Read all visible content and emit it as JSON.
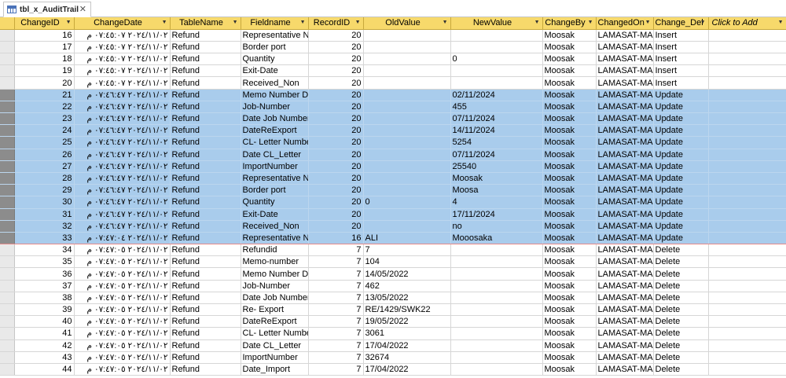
{
  "tab": {
    "title": "tbl_x_AuditTrail"
  },
  "colors": {
    "header": "#f7d96b",
    "selection": "#a9ccec",
    "selection_border": "#e58a8a"
  },
  "columns": [
    "ChangeID",
    "ChangeDate",
    "TableName",
    "Fieldname",
    "RecordID",
    "OldValue",
    "NewValue",
    "ChangeBy",
    "ChangedOn",
    "Change_Del",
    "Click to Add"
  ],
  "rows": [
    {
      "id": "16",
      "date": "٢٠٢٤/١١/٠٢ ٠٧:٤٥:٠٧ م",
      "table": "Refund",
      "field": "Representative N",
      "record": "20",
      "old": "",
      "new": "",
      "by": "Moosak",
      "on": "LAMASAT-MAI",
      "del": "Insert"
    },
    {
      "id": "17",
      "date": "٢٠٢٤/١١/٠٢ ٠٧:٤٥:٠٧ م",
      "table": "Refund",
      "field": "Border port",
      "record": "20",
      "old": "",
      "new": "",
      "by": "Moosak",
      "on": "LAMASAT-MAI",
      "del": "Insert"
    },
    {
      "id": "18",
      "date": "٢٠٢٤/١١/٠٢ ٠٧:٤٥:٠٧ م",
      "table": "Refund",
      "field": "Quantity",
      "record": "20",
      "old": "",
      "new": "0",
      "by": "Moosak",
      "on": "LAMASAT-MAI",
      "del": "Insert"
    },
    {
      "id": "19",
      "date": "٢٠٢٤/١١/٠٢ ٠٧:٤٥:٠٧ م",
      "table": "Refund",
      "field": "Exit-Date",
      "record": "20",
      "old": "",
      "new": "",
      "by": "Moosak",
      "on": "LAMASAT-MAI",
      "del": "Insert"
    },
    {
      "id": "20",
      "date": "٢٠٢٤/١١/٠٢ ٠٧:٤٥:٠٧ م",
      "table": "Refund",
      "field": "Received_Non",
      "record": "20",
      "old": "",
      "new": "",
      "by": "Moosak",
      "on": "LAMASAT-MAI",
      "del": "Insert"
    },
    {
      "id": "21",
      "date": "٢٠٢٤/١١/٠٢ ٠٧:٤٦:٤٧ م",
      "table": "Refund",
      "field": "Memo Number D",
      "record": "20",
      "old": "",
      "new": "02/11/2024",
      "by": "Moosak",
      "on": "LAMASAT-MAI",
      "del": "Update",
      "sel": true
    },
    {
      "id": "22",
      "date": "٢٠٢٤/١١/٠٢ ٠٧:٤٦:٤٧ م",
      "table": "Refund",
      "field": "Job-Number",
      "record": "20",
      "old": "",
      "new": "455",
      "by": "Moosak",
      "on": "LAMASAT-MAI",
      "del": "Update",
      "sel": true
    },
    {
      "id": "23",
      "date": "٢٠٢٤/١١/٠٢ ٠٧:٤٦:٤٧ م",
      "table": "Refund",
      "field": "Date Job Number",
      "record": "20",
      "old": "",
      "new": "07/11/2024",
      "by": "Moosak",
      "on": "LAMASAT-MAI",
      "del": "Update",
      "sel": true
    },
    {
      "id": "24",
      "date": "٢٠٢٤/١١/٠٢ ٠٧:٤٦:٤٧ م",
      "table": "Refund",
      "field": "DateReExport",
      "record": "20",
      "old": "",
      "new": "14/11/2024",
      "by": "Moosak",
      "on": "LAMASAT-MAI",
      "del": "Update",
      "sel": true
    },
    {
      "id": "25",
      "date": "٢٠٢٤/١١/٠٢ ٠٧:٤٦:٤٧ م",
      "table": "Refund",
      "field": "CL- Letter Numbe",
      "record": "20",
      "old": "",
      "new": "5254",
      "by": "Moosak",
      "on": "LAMASAT-MAI",
      "del": "Update",
      "sel": true
    },
    {
      "id": "26",
      "date": "٢٠٢٤/١١/٠٢ ٠٧:٤٦:٤٧ م",
      "table": "Refund",
      "field": "Date CL_Letter",
      "record": "20",
      "old": "",
      "new": "07/11/2024",
      "by": "Moosak",
      "on": "LAMASAT-MAI",
      "del": "Update",
      "sel": true
    },
    {
      "id": "27",
      "date": "٢٠٢٤/١١/٠٢ ٠٧:٤٦:٤٧ م",
      "table": "Refund",
      "field": "ImportNumber",
      "record": "20",
      "old": "",
      "new": "25540",
      "by": "Moosak",
      "on": "LAMASAT-MAI",
      "del": "Update",
      "sel": true
    },
    {
      "id": "28",
      "date": "٢٠٢٤/١١/٠٢ ٠٧:٤٦:٤٧ م",
      "table": "Refund",
      "field": "Representative N",
      "record": "20",
      "old": "",
      "new": "Moosak",
      "by": "Moosak",
      "on": "LAMASAT-MAI",
      "del": "Update",
      "sel": true
    },
    {
      "id": "29",
      "date": "٢٠٢٤/١١/٠٢ ٠٧:٤٦:٤٧ م",
      "table": "Refund",
      "field": "Border port",
      "record": "20",
      "old": "",
      "new": "Moosa",
      "by": "Moosak",
      "on": "LAMASAT-MAI",
      "del": "Update",
      "sel": true
    },
    {
      "id": "30",
      "date": "٢٠٢٤/١١/٠٢ ٠٧:٤٦:٤٧ م",
      "table": "Refund",
      "field": "Quantity",
      "record": "20",
      "old": "0",
      "new": "4",
      "by": "Moosak",
      "on": "LAMASAT-MAI",
      "del": "Update",
      "sel": true
    },
    {
      "id": "31",
      "date": "٢٠٢٤/١١/٠٢ ٠٧:٤٦:٤٧ م",
      "table": "Refund",
      "field": "Exit-Date",
      "record": "20",
      "old": "",
      "new": "17/11/2024",
      "by": "Moosak",
      "on": "LAMASAT-MAI",
      "del": "Update",
      "sel": true
    },
    {
      "id": "32",
      "date": "٢٠٢٤/١١/٠٢ ٠٧:٤٦:٤٧ م",
      "table": "Refund",
      "field": "Received_Non",
      "record": "20",
      "old": "",
      "new": "no",
      "by": "Moosak",
      "on": "LAMASAT-MAI",
      "del": "Update",
      "sel": true
    },
    {
      "id": "33",
      "date": "٢٠٢٤/١١/٠٢ ٠٧:٤٧:٠٤ م",
      "table": "Refund",
      "field": "Representative N",
      "record": "16",
      "old": "ALI",
      "new": "Mooosaka",
      "by": "Moosak",
      "on": "LAMASAT-MAI",
      "del": "Update",
      "sel": true
    },
    {
      "id": "34",
      "date": "٢٠٢٤/١١/٠٢ ٠٧:٤٧:٠٥ م",
      "table": "Refund",
      "field": "Refundid",
      "record": "7",
      "old": "7",
      "new": "",
      "by": "Moosak",
      "on": "LAMASAT-MAI",
      "del": "Delete"
    },
    {
      "id": "35",
      "date": "٢٠٢٤/١١/٠٢ ٠٧:٤٧:٠٥ م",
      "table": "Refund",
      "field": "Memo-number",
      "record": "7",
      "old": "104",
      "new": "",
      "by": "Moosak",
      "on": "LAMASAT-MAI",
      "del": "Delete"
    },
    {
      "id": "36",
      "date": "٢٠٢٤/١١/٠٢ ٠٧:٤٧:٠٥ م",
      "table": "Refund",
      "field": "Memo Number D",
      "record": "7",
      "old": "14/05/2022",
      "new": "",
      "by": "Moosak",
      "on": "LAMASAT-MAI",
      "del": "Delete"
    },
    {
      "id": "37",
      "date": "٢٠٢٤/١١/٠٢ ٠٧:٤٧:٠٥ م",
      "table": "Refund",
      "field": "Job-Number",
      "record": "7",
      "old": "462",
      "new": "",
      "by": "Moosak",
      "on": "LAMASAT-MAI",
      "del": "Delete"
    },
    {
      "id": "38",
      "date": "٢٠٢٤/١١/٠٢ ٠٧:٤٧:٠٥ م",
      "table": "Refund",
      "field": "Date Job Number",
      "record": "7",
      "old": "13/05/2022",
      "new": "",
      "by": "Moosak",
      "on": "LAMASAT-MAI",
      "del": "Delete"
    },
    {
      "id": "39",
      "date": "٢٠٢٤/١١/٠٢ ٠٧:٤٧:٠٥ م",
      "table": "Refund",
      "field": "Re- Export",
      "record": "7",
      "old": "RE/1429/SWK22",
      "new": "",
      "by": "Moosak",
      "on": "LAMASAT-MAI",
      "del": "Delete"
    },
    {
      "id": "40",
      "date": "٢٠٢٤/١١/٠٢ ٠٧:٤٧:٠٥ م",
      "table": "Refund",
      "field": "DateReExport",
      "record": "7",
      "old": "19/05/2022",
      "new": "",
      "by": "Moosak",
      "on": "LAMASAT-MAI",
      "del": "Delete"
    },
    {
      "id": "41",
      "date": "٢٠٢٤/١١/٠٢ ٠٧:٤٧:٠٥ م",
      "table": "Refund",
      "field": "CL- Letter Numbe",
      "record": "7",
      "old": "3061",
      "new": "",
      "by": "Moosak",
      "on": "LAMASAT-MAI",
      "del": "Delete"
    },
    {
      "id": "42",
      "date": "٢٠٢٤/١١/٠٢ ٠٧:٤٧:٠٥ م",
      "table": "Refund",
      "field": "Date CL_Letter",
      "record": "7",
      "old": "17/04/2022",
      "new": "",
      "by": "Moosak",
      "on": "LAMASAT-MAI",
      "del": "Delete"
    },
    {
      "id": "43",
      "date": "٢٠٢٤/١١/٠٢ ٠٧:٤٧:٠٥ م",
      "table": "Refund",
      "field": "ImportNumber",
      "record": "7",
      "old": "32674",
      "new": "",
      "by": "Moosak",
      "on": "LAMASAT-MAI",
      "del": "Delete"
    },
    {
      "id": "44",
      "date": "٢٠٢٤/١١/٠٢ ٠٧:٤٧:٠٥ م",
      "table": "Refund",
      "field": "Date_Import",
      "record": "7",
      "old": "17/04/2022",
      "new": "",
      "by": "Moosak",
      "on": "LAMASAT-MAI",
      "del": "Delete"
    }
  ]
}
